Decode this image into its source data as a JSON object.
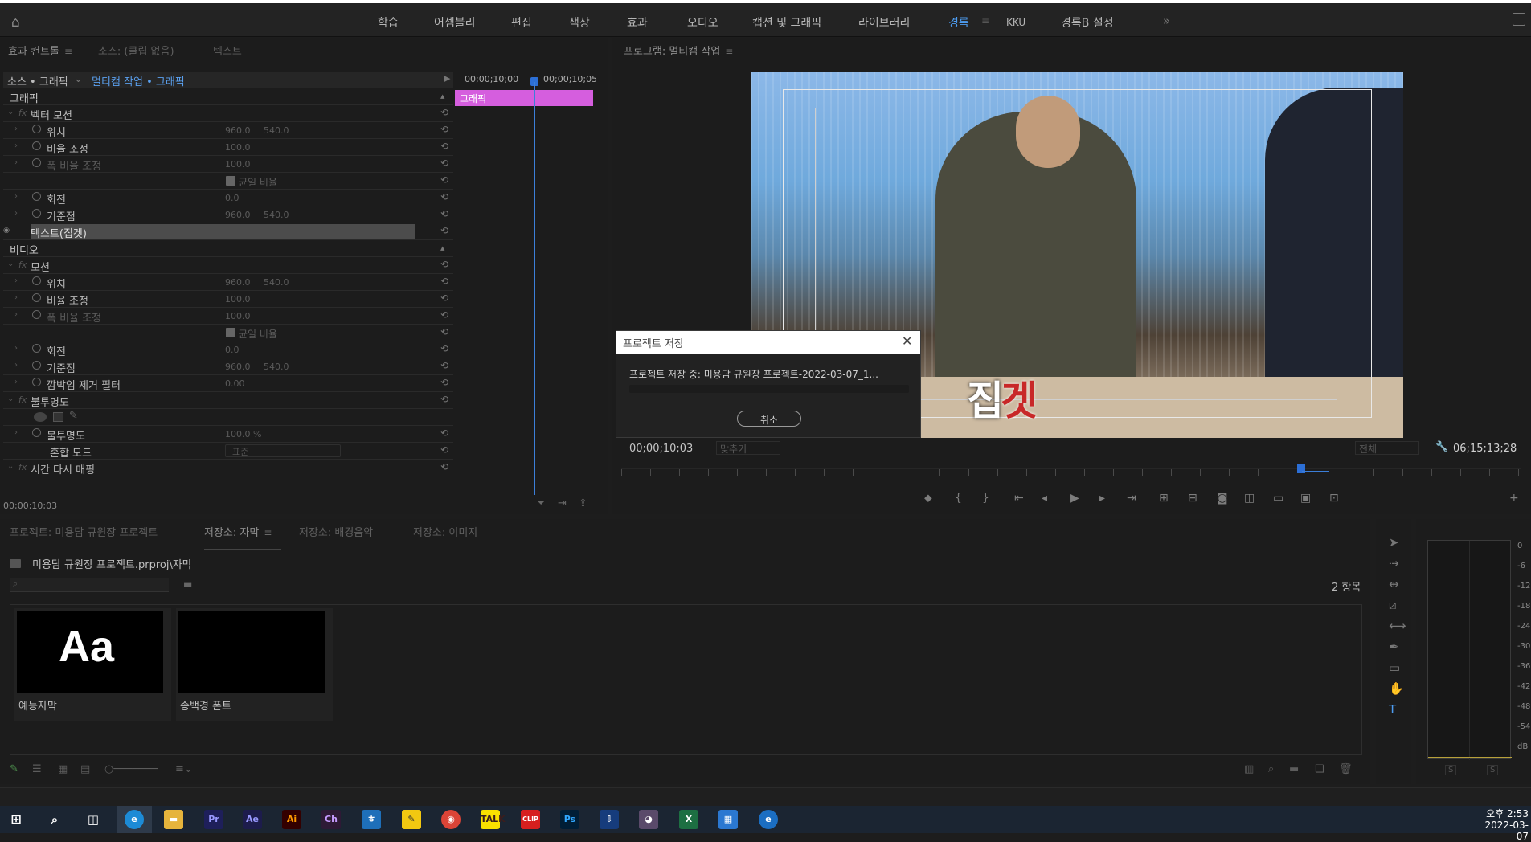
{
  "workspaces": {
    "items": [
      "학습",
      "어셈블리",
      "편집",
      "색상",
      "효과",
      "오디오",
      "캡션 및 그래픽",
      "라이브러리",
      "경록",
      "KKU",
      "경록B 설정"
    ],
    "active": "경록",
    "more": "»"
  },
  "effect_controls": {
    "tabs": [
      "효과 컨트롤",
      "소스: (클립 없음)",
      "텍스트"
    ],
    "source": "소스 • 그래픽",
    "sequence": "멀티캠 작업 • 그래픽",
    "time_start": "00;00;10;00",
    "time_end": "00;00;10;05",
    "graphic_bar": "그래픽",
    "footer_timecode": "00;00;10;03",
    "rows": [
      {
        "type": "section",
        "label": "그래픽"
      },
      {
        "type": "fx",
        "label": "벡터 모션"
      },
      {
        "type": "prop",
        "label": "위치",
        "v1": "960.0",
        "v2": "540.0"
      },
      {
        "type": "prop",
        "label": "비율 조정",
        "v1": "100.0"
      },
      {
        "type": "propdim",
        "label": "폭 비율 조정",
        "v1": "100.0"
      },
      {
        "type": "check",
        "label": "균일 비율"
      },
      {
        "type": "prop",
        "label": "회전",
        "v1": "0.0"
      },
      {
        "type": "prop",
        "label": "기준점",
        "v1": "960.0",
        "v2": "540.0"
      },
      {
        "type": "selected",
        "label": "텍스트(집겟)"
      },
      {
        "type": "section",
        "label": "비디오"
      },
      {
        "type": "fx",
        "label": "모션"
      },
      {
        "type": "prop",
        "label": "위치",
        "v1": "960.0",
        "v2": "540.0"
      },
      {
        "type": "prop",
        "label": "비율 조정",
        "v1": "100.0"
      },
      {
        "type": "propdim",
        "label": "폭 비율 조정",
        "v1": "100.0"
      },
      {
        "type": "check",
        "label": "균일 비율"
      },
      {
        "type": "prop",
        "label": "회전",
        "v1": "0.0"
      },
      {
        "type": "prop",
        "label": "기준점",
        "v1": "960.0",
        "v2": "540.0"
      },
      {
        "type": "prop",
        "label": "깜박임 제거 필터",
        "v1": "0.00"
      },
      {
        "type": "fx",
        "label": "불투명도"
      },
      {
        "type": "masks",
        "label": ""
      },
      {
        "type": "prop",
        "label": "불투명도",
        "v1": "100.0 %"
      },
      {
        "type": "blend",
        "label": "혼합 모드",
        "v1": "표준"
      },
      {
        "type": "fx",
        "label": "시간 다시 매핑"
      }
    ]
  },
  "program_monitor": {
    "title": "프로그램: 멀티캠 작업",
    "caption_white": "집",
    "caption_red": "겟",
    "timecode": "00;00;10;03",
    "fit": "맞추기",
    "quality": "전체",
    "duration": "06;15;13;28"
  },
  "dialog": {
    "title": "프로젝트 저장",
    "message": "프로젝트 저장 중: 미용담 규원장 프로젝트-2022-03-07_1...",
    "cancel": "취소",
    "progress": 0
  },
  "project": {
    "tabs": [
      "프로젝트: 미용담 규원장 프로젝트",
      "저장소: 자막",
      "저장소: 배경음악",
      "저장소: 이미지"
    ],
    "active_tab": "저장소: 자막",
    "path": "미용담 규원장 프로젝트.prproj\\자막",
    "count": "2 항목",
    "items": [
      {
        "name": "예능자막",
        "thumb_text": "Aa"
      },
      {
        "name": "송백경 폰트",
        "thumb_text": ""
      }
    ]
  },
  "meter": {
    "labels": [
      "0",
      "-6",
      "-12",
      "-18",
      "-24",
      "-30",
      "-36",
      "-42",
      "-48",
      "-54",
      "dB"
    ],
    "solo": [
      "S",
      "S"
    ]
  },
  "taskbar": {
    "time": "오후 2:53",
    "date": "2022-03-07"
  }
}
